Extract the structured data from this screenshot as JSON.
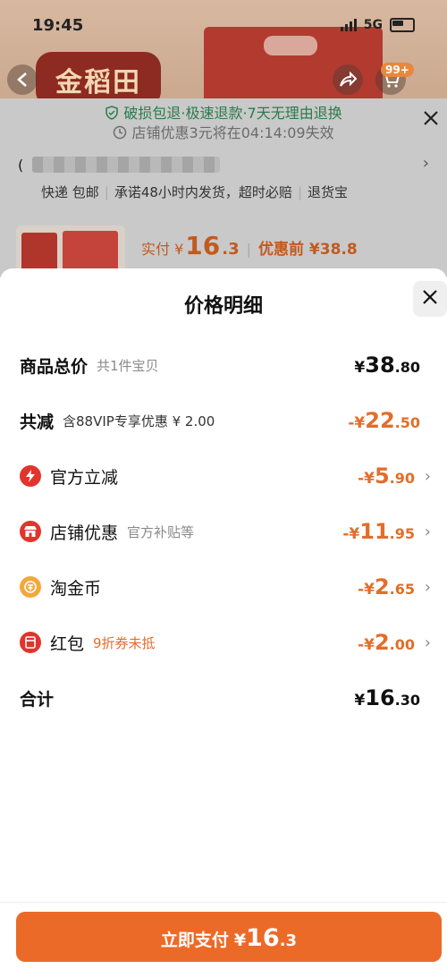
{
  "status_bar": {
    "time": "19:45",
    "network": "5G"
  },
  "background": {
    "brand_logo_text": "金稻田",
    "cart_badge": "99+",
    "guarantee_line1": "破损包退·极速退款·7天无理由退换",
    "guarantee_line2_prefix": "店铺优惠3元将在",
    "guarantee_countdown": "04:14:09",
    "guarantee_line2_suffix": "失效",
    "address_prefix": "(",
    "shipping": [
      "快递 包邮",
      "承诺48小时内发货，超时必赔",
      "退货宝"
    ],
    "price_label": "实付 ¥",
    "price_int": "16",
    "price_dec": ".3",
    "before_label": "优惠前 ¥38.8"
  },
  "sheet": {
    "title": "价格明细",
    "rows": [
      {
        "label": "商品总价",
        "sub": "共1件宝贝",
        "prefix": "¥",
        "int": "38",
        "dec": ".80"
      },
      {
        "label": "共减",
        "sub": "含88VIP专享优惠 ¥ 2.00",
        "prefix": "-¥",
        "int": "22",
        "dec": ".50"
      },
      {
        "label": "官方立减",
        "icon": "lightning-icon",
        "prefix": "-¥",
        "int": "5",
        "dec": ".90"
      },
      {
        "label": "店铺优惠",
        "sub": "官方补贴等",
        "icon": "store-icon",
        "prefix": "-¥",
        "int": "11",
        "dec": ".95"
      },
      {
        "label": "淘金币",
        "icon": "coin-icon",
        "prefix": "-¥",
        "int": "2",
        "dec": ".65"
      },
      {
        "label": "红包",
        "sub": "9折券未抵",
        "icon": "red-envelope-icon",
        "prefix": "-¥",
        "int": "2",
        "dec": ".00"
      },
      {
        "label": "合计",
        "prefix": "¥",
        "int": "16",
        "dec": ".30"
      }
    ]
  },
  "pay_button": {
    "label": "立即支付",
    "prefix": "¥",
    "int": "16",
    "dec": ".3"
  },
  "colors": {
    "accent": "#ec6a28",
    "discount": "#e36d2a",
    "icon_red": "#e0342d",
    "coin": "#f2a93b"
  }
}
